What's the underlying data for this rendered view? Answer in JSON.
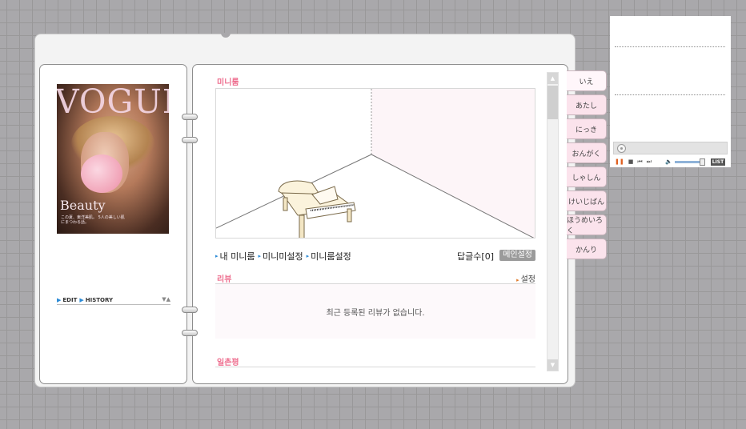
{
  "profile": {
    "edit_label": "EDIT",
    "history_label": "HISTORY",
    "photo": {
      "magazine": "VOGUE",
      "headline": "Beauty",
      "caption": "この夏、東洋美肌。 5人の美しい肌にまつわる話。"
    }
  },
  "miniroom": {
    "title": "미니룸",
    "nav": [
      "내 미니룸",
      "미니미설정",
      "미니룸설정"
    ],
    "reply_count": "답글수[0]",
    "main_setting_label": "메인설정"
  },
  "review": {
    "title": "리뷰",
    "setting_label": "설정",
    "empty_message": "최근 등록된 리뷰가 없습니다."
  },
  "guestline": {
    "title": "일촌평"
  },
  "menu_tabs": [
    "いえ",
    "あたし",
    "にっき",
    "おんがく",
    "しゃしん",
    "けいじばん",
    "ほうめいろく",
    "かんり"
  ],
  "player": {
    "list_label": "LIST"
  },
  "colors": {
    "accent_pink": "#ee6f8f",
    "tab_pink": "#fbe3ec",
    "link_blue": "#2a8ad6"
  }
}
